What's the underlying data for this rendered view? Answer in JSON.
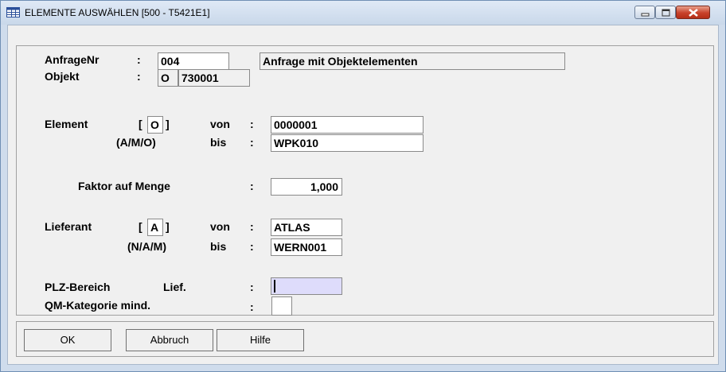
{
  "window": {
    "title": "ELEMENTE AUSWÄHLEN  [500 - T5421E1]",
    "title_icon": "table-icon",
    "caption_buttons": [
      "minimize-icon",
      "maximize-icon",
      "close-icon"
    ],
    "close_color": "#c8412a"
  },
  "form": {
    "anfrage": {
      "label": "AnfrageNr",
      "colon": ":",
      "value": "004",
      "description": "Anfrage mit Objektelementen"
    },
    "objekt": {
      "label": "Objekt",
      "colon": ":",
      "type": "O",
      "value": "730001"
    },
    "element": {
      "label": "Element",
      "bracket_open": "[",
      "type": "O",
      "bracket_close": "]",
      "hint": "(A/M/O)",
      "von_label": "von",
      "bis_label": "bis",
      "colon": ":",
      "von": "0000001",
      "bis": "WPK010"
    },
    "faktor": {
      "label": "Faktor auf Menge",
      "colon": ":",
      "value": "1,000"
    },
    "lieferant": {
      "label": "Lieferant",
      "bracket_open": "[",
      "type": "A",
      "bracket_close": "]",
      "hint": "(N/A/M)",
      "von_label": "von",
      "bis_label": "bis",
      "colon": ":",
      "von": "ATLAS",
      "bis": "WERN001"
    },
    "plz": {
      "label": "PLZ-Bereich",
      "sub": "Lief.",
      "colon": ":",
      "value": ""
    },
    "qm": {
      "label": "QM-Kategorie mind.",
      "colon": ":",
      "value": ""
    }
  },
  "buttons": {
    "ok": "OK",
    "cancel": "Abbruch",
    "help": "Hilfe"
  }
}
